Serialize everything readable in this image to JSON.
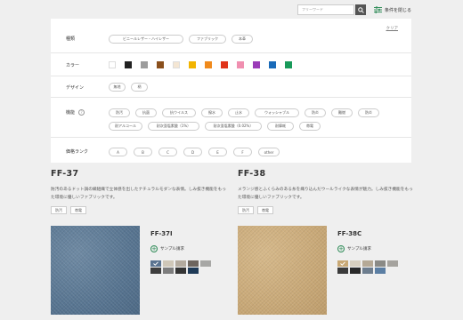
{
  "topbar": {
    "search_placeholder": "フリーワード",
    "close_filter_label": "条件を閉じる"
  },
  "filter": {
    "clear_label": "クリア",
    "kind": {
      "label": "種類",
      "options": [
        "ビニールレザー・ハイレザー",
        "ファブリック",
        "本革"
      ]
    },
    "color": {
      "label": "カラー",
      "swatches": [
        "#ffffff",
        "#222222",
        "#9c9c9c",
        "#8a4f1c",
        "#f4e6d3",
        "#f2b400",
        "#f08a1c",
        "#e0341a",
        "#f08fb0",
        "#9b3cb8",
        "#1a6ab8",
        "#199a5a"
      ]
    },
    "design": {
      "label": "デザイン",
      "options": [
        "無地",
        "柄"
      ]
    },
    "function": {
      "label": "機能",
      "help": "?",
      "options": [
        "防汚",
        "抗菌",
        "抗ウイルス",
        "撥水",
        "止水",
        "ウォッシャブル",
        "防炎",
        "難燃",
        "防炎",
        "耐アルコール",
        "耐次亜塩素酸（1%）",
        "耐次亜塩素酸（0.02%）",
        "耐摩耗",
        "帯電"
      ]
    },
    "price": {
      "label": "価格ランク",
      "options": [
        "A",
        "B",
        "C",
        "D",
        "E",
        "F",
        "other"
      ]
    }
  },
  "products": [
    {
      "title": "FF-37",
      "description": "防汚のあるドット調の織組織で立体感を出したナチュラルモダンな表情。しみ抜き機能をもった環境に優しいファブリックです。",
      "tags": [
        "防汚",
        "帯電"
      ],
      "code": "FF-37I",
      "sample_label": "サンプル請求",
      "colors": [
        "#5a7390",
        "#cfc7b8",
        "#b3aa9e",
        "#6e655e",
        "#a7a7a5",
        "#3e3e3e",
        "#7d7d7d",
        "#343434",
        "#1f3a57"
      ]
    },
    {
      "title": "FF-38",
      "description": "メランジ感とふくらみのある糸を織り込んだウールライクな表情が魅力。しみ抜き機能をもった環境に優しいファブリックです。",
      "tags": [
        "防汚",
        "帯電"
      ],
      "code": "FF-38C",
      "sample_label": "サンプル請求",
      "colors": [
        "#c8a875",
        "#d8d0c0",
        "#b5a996",
        "#8a8a86",
        "#a5a39e",
        "#3b3b3b",
        "#2a2a2a",
        "#6d7d8e",
        "#5b7ea3"
      ]
    }
  ]
}
